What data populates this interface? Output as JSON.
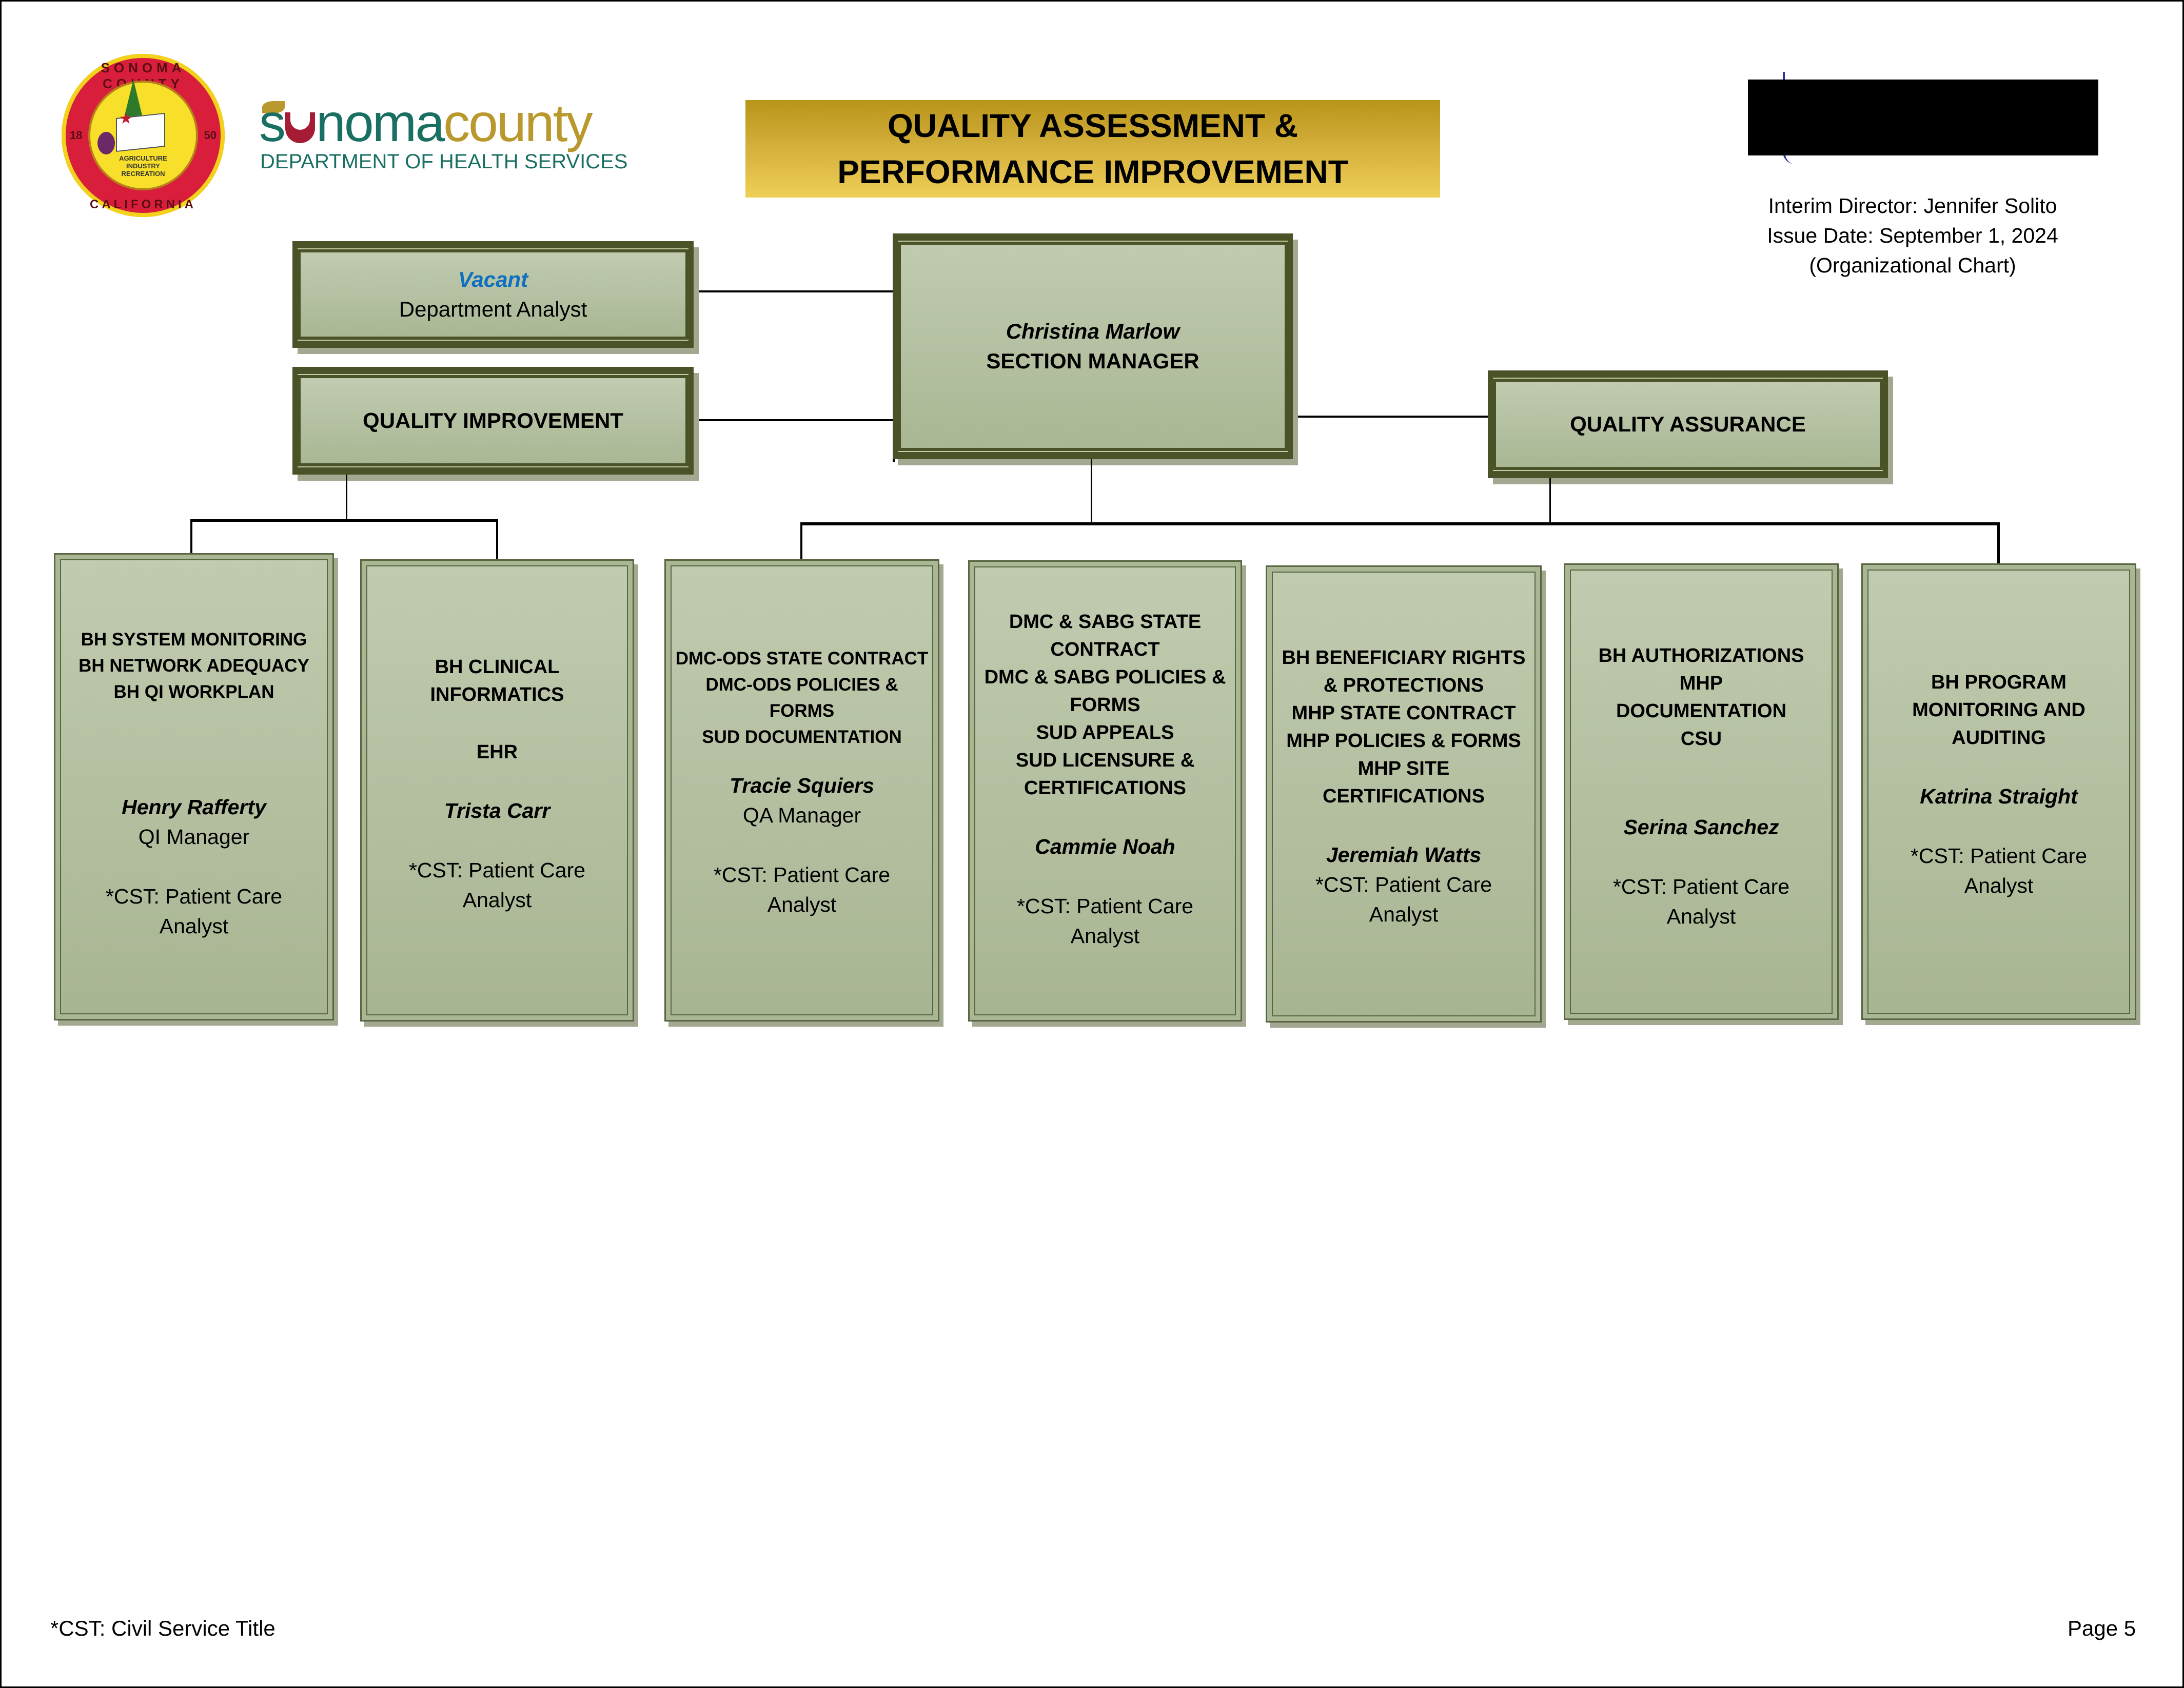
{
  "header": {
    "seal": {
      "top_text": "SONOMA COUNTY",
      "bottom_text": "CALIFORNIA",
      "year_left": "18",
      "year_right": "50",
      "motto": [
        "AGRICULTURE",
        "INDUSTRY",
        "RECREATION"
      ]
    },
    "brand": {
      "word_part1": "s",
      "word_part2": "noma",
      "word_part3": "county",
      "subtitle": "DEPARTMENT OF HEALTH SERVICES",
      "colors": {
        "teal": "#1a6f63",
        "gold": "#b9992d",
        "red": "#a51c34"
      }
    },
    "title_lines": [
      "QUALITY ASSESSMENT &",
      "PERFORMANCE IMPROVEMENT"
    ],
    "title_color": "#d2ae3a",
    "director_lines": [
      "Interim Director: Jennifer Solito",
      "Issue Date: September 1, 2024",
      "(Organizational Chart)"
    ]
  },
  "org": {
    "dept_analyst": {
      "name": "Vacant",
      "role": "Department Analyst"
    },
    "section_manager": {
      "name": "Christina Marlow",
      "role": "SECTION MANAGER"
    },
    "quality_improvement": {
      "label": "QUALITY IMPROVEMENT"
    },
    "quality_assurance": {
      "label": "QUALITY ASSURANCE"
    },
    "units": [
      {
        "areas": [
          "BH SYSTEM MONITORING",
          "BH NETWORK ADEQUACY",
          "BH QI WORKPLAN"
        ],
        "person": "Henry Rafferty",
        "title": "QI Manager",
        "cst": [
          "*CST: Patient Care",
          "Analyst"
        ],
        "parent": "QUALITY IMPROVEMENT"
      },
      {
        "areas": [
          "BH CLINICAL",
          "INFORMATICS",
          "",
          "EHR"
        ],
        "person": "Trista Carr",
        "title": "",
        "cst": [
          "*CST: Patient Care",
          "Analyst"
        ],
        "parent": "QUALITY IMPROVEMENT"
      },
      {
        "areas": [
          "DMC-ODS STATE CONTRACT",
          "DMC-ODS POLICIES &",
          "FORMS",
          "SUD DOCUMENTATION"
        ],
        "person": "Tracie Squiers",
        "title": "QA Manager",
        "cst": [
          "*CST: Patient Care",
          "Analyst"
        ],
        "parent": "QUALITY ASSURANCE"
      },
      {
        "areas": [
          "DMC & SABG STATE",
          "CONTRACT",
          "DMC & SABG POLICIES &",
          "FORMS",
          "SUD APPEALS",
          "SUD LICENSURE &",
          "CERTIFICATIONS"
        ],
        "person": "Cammie Noah",
        "title": "",
        "cst": [
          "*CST: Patient Care",
          "Analyst"
        ],
        "parent": "QUALITY ASSURANCE"
      },
      {
        "areas": [
          "BH BENEFICIARY RIGHTS",
          "& PROTECTIONS",
          "MHP STATE CONTRACT",
          "MHP POLICIES & FORMS",
          "MHP SITE",
          "CERTIFICATIONS"
        ],
        "person": "Jeremiah Watts",
        "title": "",
        "cst": [
          "*CST: Patient Care",
          "Analyst"
        ],
        "parent": "QUALITY ASSURANCE"
      },
      {
        "areas": [
          "BH AUTHORIZATIONS",
          "MHP",
          "DOCUMENTATION",
          "CSU"
        ],
        "person": "Serina Sanchez",
        "title": "",
        "cst": [
          "*CST: Patient Care",
          "Analyst"
        ],
        "parent": "QUALITY ASSURANCE"
      },
      {
        "areas": [
          "BH PROGRAM",
          "MONITORING AND",
          "AUDITING"
        ],
        "person": "Katrina Straight",
        "title": "",
        "cst": [
          "*CST: Patient Care",
          "Analyst"
        ],
        "parent": "QUALITY ASSURANCE"
      }
    ],
    "colors": {
      "box_dark": "#4a5228",
      "box_light_top": "#c1cbb0",
      "box_light_bottom": "#a9b794",
      "vacant_blue": "#0f6fc0"
    }
  },
  "footer": {
    "note": "*CST: Civil Service Title",
    "page": "Page 5"
  }
}
